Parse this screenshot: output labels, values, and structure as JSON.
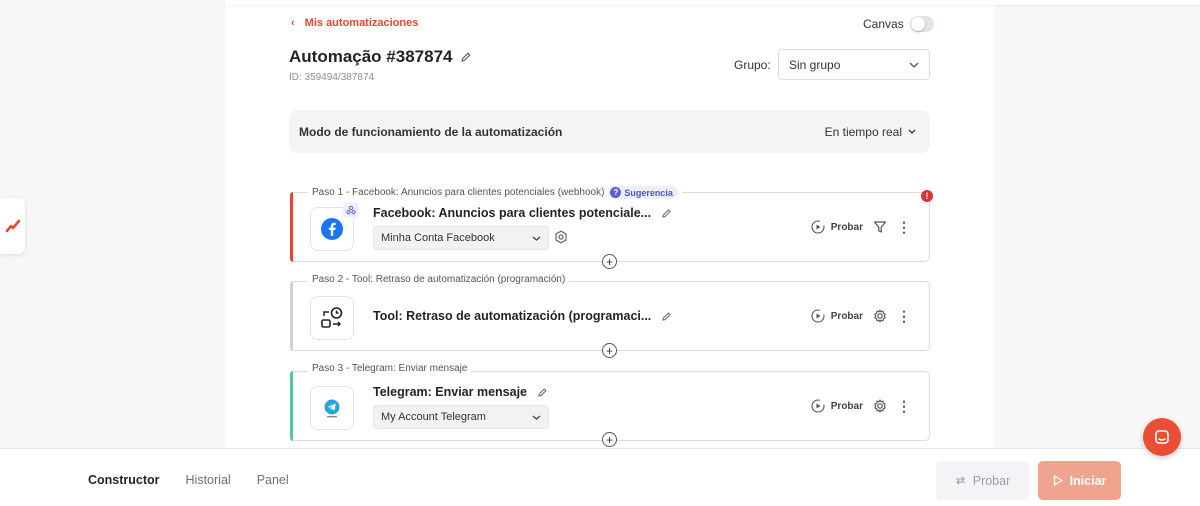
{
  "header": {
    "back_label": "Mis automatizaciones",
    "canvas_label": "Canvas",
    "title": "Automação #387874",
    "id_text": "ID: 359494/387874",
    "group_label": "Grupo:",
    "group_value": "Sin grupo"
  },
  "mode": {
    "title": "Modo de funcionamiento de la automatización",
    "value": "En tiempo real"
  },
  "steps": [
    {
      "label": "Paso 1 - Facebook: Anuncios para clientes potenciales (webhook)",
      "hint": "Sugerencia",
      "name": "Facebook: Anuncios para clientes potenciale...",
      "account": "Minha Conta Facebook",
      "probar": "Probar",
      "accent": "#e8472b"
    },
    {
      "label": "Paso 2 - Tool: Retraso de automatización (programación)",
      "name": "Tool: Retraso de automatización (programaci...",
      "probar": "Probar",
      "accent": "#d0d2d6"
    },
    {
      "label": "Paso 3 - Telegram: Enviar mensaje",
      "name": "Telegram: Enviar mensaje",
      "account": "My Account Telegram",
      "probar": "Probar",
      "accent": "#52c9a2"
    }
  ],
  "alert_badge": "!",
  "bottom": {
    "tabs": [
      "Constructor",
      "Historial",
      "Panel"
    ],
    "probar_label": "Probar",
    "iniciar_label": "Iniciar"
  },
  "colors": {
    "brand": "#e8472b",
    "iniciar_bg": "#f0a48f",
    "hint": "#5b5fd6"
  }
}
